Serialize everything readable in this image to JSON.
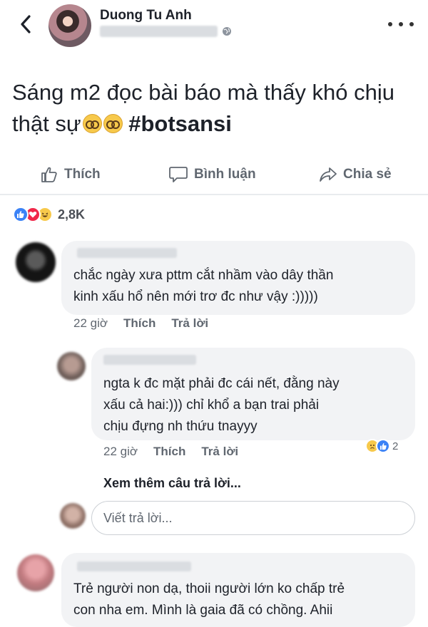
{
  "post": {
    "author": "Duong Tu Anh",
    "text": "Sáng m2 đọc bài báo mà thấy khó chịu thật sự",
    "hashtag": "#botsansi"
  },
  "actions": {
    "like_label": "Thích",
    "comment_label": "Bình luận",
    "share_label": "Chia sẻ"
  },
  "reactions": {
    "count": "2,8K",
    "types": [
      "like-icon",
      "love-icon",
      "haha-icon"
    ]
  },
  "comments": [
    {
      "text": "chắc ngày xưa pttm cắt nhầm vào dây thần\nkinh xấu hổ nên mới trơ đc như vậy :)))))",
      "time": "22 giờ",
      "like_label": "Thích",
      "reply_label": "Trả lời"
    },
    {
      "text": "ngta k đc mặt phải đc cái nết, đằng này\nxấu cả hai:))) chỉ khổ a bạn trai phải\nchịu đựng nh thứu tnayyy",
      "time": "22 giờ",
      "like_label": "Thích",
      "reply_label": "Trả lời",
      "reaction_count": "2"
    },
    {
      "text": "Trẻ người non dạ, thoii người lớn ko chấp trẻ\ncon nha em. Mình là gaia đã có chồng. Ahii"
    }
  ],
  "more_replies": "Xem thêm câu trả lời...",
  "reply_input": {
    "placeholder": "Viết trả lời..."
  },
  "colors": {
    "text_primary": "#1d2129",
    "text_secondary": "#606770",
    "bubble_bg": "#f2f3f5",
    "like_blue": "#3b82f6",
    "love_red": "#f0284a",
    "haha_yellow": "#f7c94b"
  }
}
